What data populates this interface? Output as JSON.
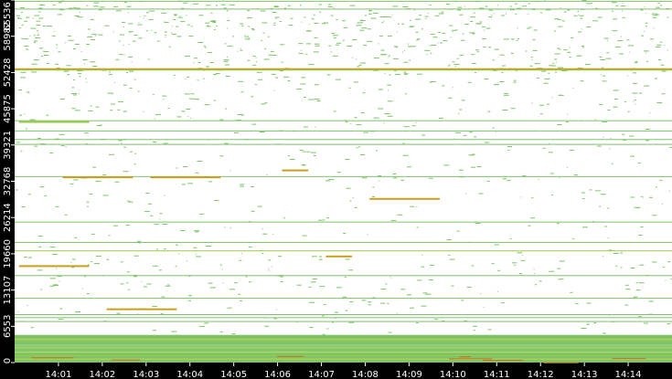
{
  "chart_data": {
    "type": "heatmap",
    "title": "",
    "xlabel": "",
    "ylabel": "",
    "x_tick_labels": [
      "14:01",
      "14:02",
      "14:03",
      "14:04",
      "14:05",
      "14:06",
      "14:07",
      "14:08",
      "14:09",
      "14:10",
      "14:11",
      "14:12",
      "14:13",
      "14:14"
    ],
    "y_tick_labels": [
      "0",
      "6553",
      "13107",
      "19660",
      "26214",
      "32768",
      "39321",
      "45875",
      "52428",
      "58982",
      "65536"
    ],
    "y_tick_values": [
      0,
      6553,
      13107,
      19660,
      26214,
      32768,
      39321,
      45875,
      52428,
      58982,
      65536
    ],
    "ylim": [
      0,
      65536
    ],
    "x_range_minutes": [
      "14:00",
      "14:15"
    ],
    "grid": false,
    "colors": {
      "background": "#000000",
      "plot_background": "#ffffff",
      "low_activity": "#7ec26a",
      "medium_activity": "#9acb4a",
      "high_activity": "#c8a020",
      "peak_activity": "#c87020",
      "axis_text": "#ffffff"
    },
    "persistent_bands": [
      {
        "y": 65390,
        "start": "14:00",
        "end": "14:15",
        "level": "low"
      },
      {
        "y": 63980,
        "start": "14:00",
        "end": "14:15",
        "level": "low"
      },
      {
        "y": 53200,
        "start": "14:00",
        "end": "14:15",
        "level": "high"
      },
      {
        "y": 52950,
        "start": "14:00",
        "end": "14:15",
        "level": "medium"
      },
      {
        "y": 43800,
        "start": "14:00",
        "end": "14:15",
        "level": "low"
      },
      {
        "y": 41950,
        "start": "14:00",
        "end": "14:15",
        "level": "low"
      },
      {
        "y": 40400,
        "start": "14:00",
        "end": "14:15",
        "level": "low"
      },
      {
        "y": 39520,
        "start": "14:00",
        "end": "14:15",
        "level": "low"
      },
      {
        "y": 33700,
        "start": "14:00",
        "end": "14:15",
        "level": "low"
      },
      {
        "y": 25480,
        "start": "14:00",
        "end": "14:15",
        "level": "low"
      },
      {
        "y": 21800,
        "start": "14:00",
        "end": "14:15",
        "level": "low"
      },
      {
        "y": 20270,
        "start": "14:00",
        "end": "14:15",
        "level": "medium"
      },
      {
        "y": 15800,
        "start": "14:00",
        "end": "14:15",
        "level": "low"
      },
      {
        "y": 11700,
        "start": "14:00",
        "end": "14:15",
        "level": "low"
      },
      {
        "y": 8750,
        "start": "14:00",
        "end": "14:15",
        "level": "low"
      },
      {
        "y": 8200,
        "start": "14:00",
        "end": "14:15",
        "level": "low"
      },
      {
        "y": 7500,
        "start": "14:00",
        "end": "14:15",
        "level": "low"
      }
    ],
    "short_bands": [
      {
        "y": 43650,
        "start": "14:00",
        "end": "14:01",
        "level": "medium"
      },
      {
        "y": 34900,
        "start": "14:06",
        "end": "14:06",
        "level": "high"
      },
      {
        "y": 33650,
        "start": "14:01",
        "end": "14:02",
        "level": "high"
      },
      {
        "y": 33650,
        "start": "14:03",
        "end": "14:04",
        "level": "high"
      },
      {
        "y": 29750,
        "start": "14:08",
        "end": "14:09",
        "level": "high"
      },
      {
        "y": 17600,
        "start": "14:00",
        "end": "14:01",
        "level": "high"
      },
      {
        "y": 19350,
        "start": "14:07",
        "end": "14:07",
        "level": "high"
      },
      {
        "y": 9800,
        "start": "14:02",
        "end": "14:03",
        "level": "high"
      }
    ],
    "dense_region": {
      "y_min": 0,
      "y_max": 5000,
      "level": "low"
    }
  }
}
